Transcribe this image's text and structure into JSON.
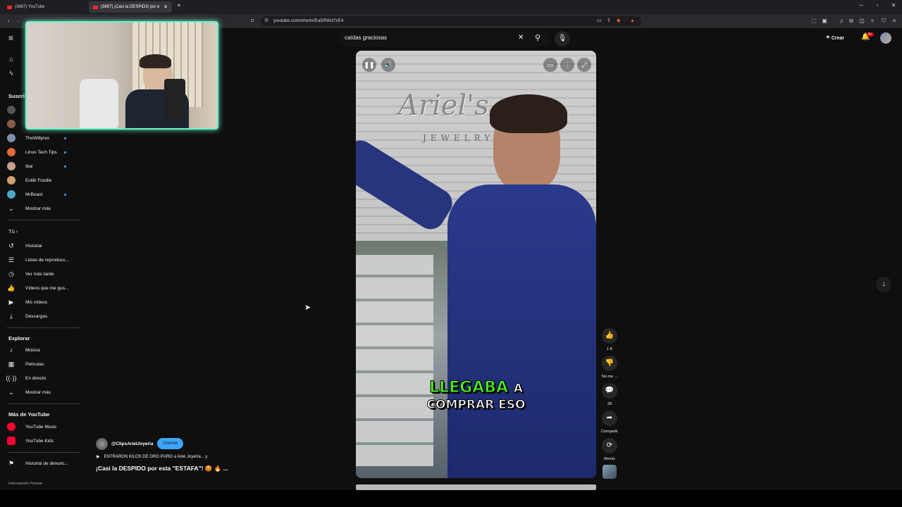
{
  "browser": {
    "tabs": [
      {
        "label": "(3867) YouTube"
      },
      {
        "label": "(3867) ¡Casi la DESPIDO por e"
      }
    ],
    "url": "youtube.com/shorts/EaDR8ct7zE4",
    "window_controls": {
      "minimize": "─",
      "restore": "▫",
      "close": "✕"
    }
  },
  "header": {
    "search_value": "caídas graciosas",
    "create_label": "Crear",
    "notif_count": "9+"
  },
  "sidebar": {
    "subscriptions_heading": "Suscri",
    "subscriptions": [
      {
        "label": "TheWillyrex",
        "color": "#7a8ea8"
      },
      {
        "label": "Linus Tech Tips",
        "color": "#e06a3a"
      },
      {
        "label": "Ibai",
        "color": "#c9a08a"
      },
      {
        "label": "Estilk Foodie",
        "color": "#cfa070"
      },
      {
        "label": "MrBeast",
        "color": "#4aa6c9"
      }
    ],
    "show_more_1": "Mostrar más",
    "you_heading": "Tú",
    "you_items": [
      {
        "label": "Historial",
        "icon": "history-icon"
      },
      {
        "label": "Listas de reproducc...",
        "icon": "playlist-icon"
      },
      {
        "label": "Ver más tarde",
        "icon": "clock-icon"
      },
      {
        "label": "Vídeos que me gus...",
        "icon": "like-icon"
      },
      {
        "label": "Mis vídeos",
        "icon": "video-icon"
      },
      {
        "label": "Descargas",
        "icon": "download-icon"
      }
    ],
    "explore_heading": "Explorar",
    "explore_items": [
      {
        "label": "Música",
        "icon": "music-icon"
      },
      {
        "label": "Películas",
        "icon": "film-icon"
      },
      {
        "label": "En directo",
        "icon": "live-icon"
      }
    ],
    "show_more_2": "Mostrar más",
    "more_heading": "Más de YouTube",
    "more_items": [
      {
        "label": "YouTube Music"
      },
      {
        "label": "YouTube Kids"
      }
    ],
    "report_history": "Historial de denunc...",
    "footer_links": "Información  Prensa"
  },
  "video": {
    "caption_highlight": "LLEGABA",
    "caption_word": "A",
    "caption_line2": "COMPRAR ESO",
    "brand_text": "Ariel's",
    "brand_sub": "JEWELRY"
  },
  "actions": {
    "likes": "1 K",
    "dislike": "No me ...",
    "comments": "28",
    "share": "Compartir",
    "remix": "Remix"
  },
  "channel": {
    "name": "@ClipsArielJoyeria",
    "join_label": "Unirme",
    "song": "ENTRARON KILOS DE ORO PURO a Ariel Joyería... y",
    "title": "¡Casi la DESPIDO por esta \"ESTAFA\"! 😡 🔥 ..."
  }
}
